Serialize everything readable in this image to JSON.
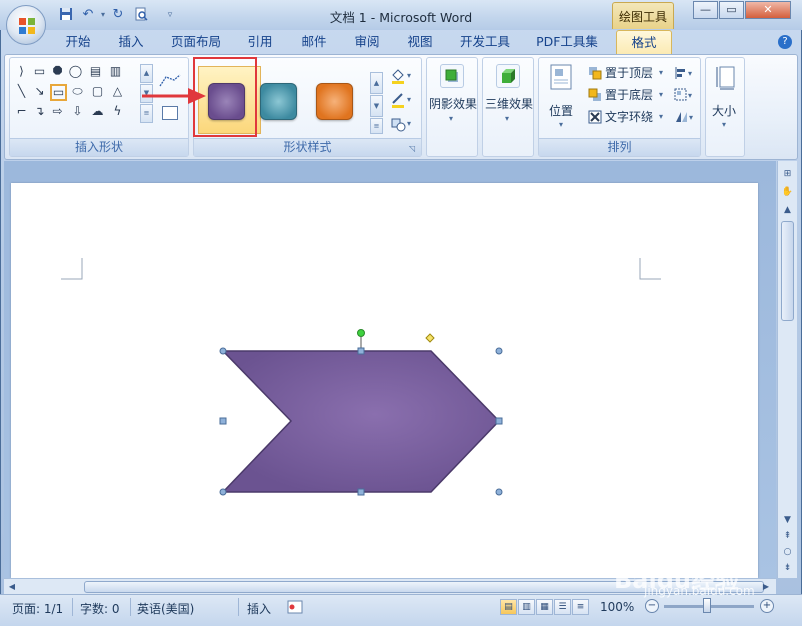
{
  "window": {
    "title": "文档 1 - Microsoft Word",
    "context_tool": "绘图工具",
    "minimize_label": "—",
    "maximize_label": "▭",
    "close_label": "✕"
  },
  "quick_access": {
    "save_icon": "save-icon",
    "undo_icon": "undo-icon",
    "redo_icon": "redo-icon",
    "preview_icon": "print-preview-icon",
    "customize_icon": "customize-icon"
  },
  "tabs": [
    {
      "label": "开始"
    },
    {
      "label": "插入"
    },
    {
      "label": "页面布局"
    },
    {
      "label": "引用"
    },
    {
      "label": "邮件"
    },
    {
      "label": "审阅"
    },
    {
      "label": "视图"
    },
    {
      "label": "开发工具"
    },
    {
      "label": "PDF工具集"
    },
    {
      "label": "格式",
      "active": true
    }
  ],
  "ribbon": {
    "insert_shapes": {
      "label": "插入形状"
    },
    "shape_styles": {
      "label": "形状样式",
      "styles": [
        {
          "name": "purple-style",
          "color": "#6a4d8e",
          "highlight": "#9a84b8"
        },
        {
          "name": "teal-style",
          "color": "#3d8aa0",
          "highlight": "#8cc7d4"
        },
        {
          "name": "orange-style",
          "color": "#e0741f",
          "highlight": "#f6b27a"
        }
      ],
      "selected_index": 0
    },
    "shadow_effects": {
      "label": "阴影效果"
    },
    "effects_3d": {
      "label": "三维效果"
    },
    "arrange": {
      "label": "排列",
      "position_label": "位置",
      "bring_front_label": "置于顶层",
      "send_back_label": "置于底层",
      "text_wrap_label": "文字环绕"
    },
    "size": {
      "label": "大小"
    }
  },
  "document": {
    "shape": {
      "type": "chevron",
      "fill": "#6b5391",
      "fill_highlight": "#8a6fae",
      "outline": "#4b3a6a"
    },
    "highlight_box_color": "#e0383c",
    "arrow_color": "#e0383c"
  },
  "statusbar": {
    "page": "页面: 1/1",
    "words": "字数: 0",
    "language": "英语(美国)",
    "mode": "插入",
    "zoom": "100%"
  },
  "watermark": {
    "text_main": "Baidu经验",
    "text_url": "jingyan.baidu.com"
  }
}
